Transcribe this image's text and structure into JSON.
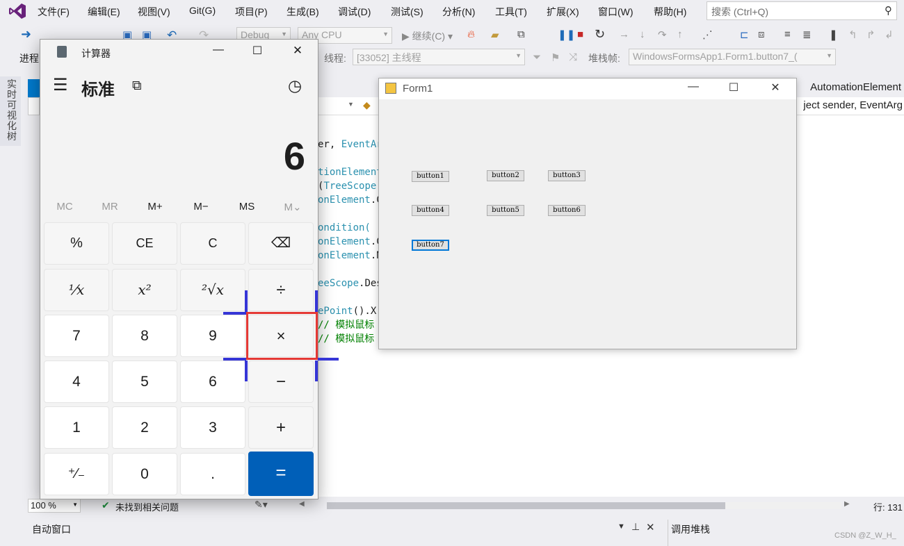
{
  "menu": [
    "文件(F)",
    "编辑(E)",
    "视图(V)",
    "Git(G)",
    "项目(P)",
    "生成(B)",
    "调试(D)",
    "测试(S)",
    "分析(N)",
    "工具(T)",
    "扩展(X)",
    "窗口(W)",
    "帮助(H)"
  ],
  "search": {
    "placeholder": "搜索 (Ctrl+Q)"
  },
  "toolbar": {
    "config": "Debug",
    "platform": "Any CPU",
    "continue": "继续(C)",
    "process_label": "进程",
    "thread_label": "线程:",
    "thread_value": "[33052] 主线程",
    "stack_label": "堆栈帧:",
    "stack_value": "WindowsFormsApp1.Form1.button7_("
  },
  "side_tab": "实时可视化树",
  "editor": {
    "tab_right": "AutomationElement",
    "nav_right": "ject sender, EventArg",
    "code_lines": [
      {
        "t": "er, ",
        "k": "EventAr",
        "c": ""
      },
      {
        "t": "",
        "k": "tionElement",
        "c": ""
      },
      {
        "t": "(",
        "k": "TreeScope",
        "c": "."
      },
      {
        "t": "",
        "k": "onElement",
        "c": ".C"
      },
      {
        "t": "",
        "k": "ondition(",
        "c": ""
      },
      {
        "t": "",
        "k": "onElement",
        "c": ".C"
      },
      {
        "t": "",
        "k": "onElement",
        "c": ".N"
      },
      {
        "t": "",
        "k": "eeScope",
        "c": ".Des"
      },
      {
        "t": "",
        "k": "ePoint",
        "c": "().X,"
      },
      {
        "t": "",
        "k": "",
        "c": "// 模拟鼠标"
      },
      {
        "t": "",
        "k": "",
        "c": "// 模拟鼠标"
      }
    ]
  },
  "status": {
    "zoom": "100 %",
    "issues": "未找到相关问题",
    "line": "行: 131"
  },
  "panels": {
    "auto": "自动窗口",
    "callstack": "调用堆栈"
  },
  "form1": {
    "title": "Form1",
    "buttons": [
      "button1",
      "button2",
      "button3",
      "button4",
      "button5",
      "button6",
      "button7"
    ]
  },
  "calc": {
    "title": "计算器",
    "mode": "标准",
    "display": "6",
    "memory": [
      "MC",
      "MR",
      "M+",
      "M−",
      "MS",
      "M⌄"
    ],
    "keys": [
      "%",
      "CE",
      "C",
      "⌫",
      "¹⁄x",
      "x²",
      "²√x",
      "÷",
      "7",
      "8",
      "9",
      "×",
      "4",
      "5",
      "6",
      "−",
      "1",
      "2",
      "3",
      "+",
      "⁺⁄₋",
      "0",
      ".",
      "="
    ]
  },
  "watermark": "CSDN @Z_W_H_"
}
